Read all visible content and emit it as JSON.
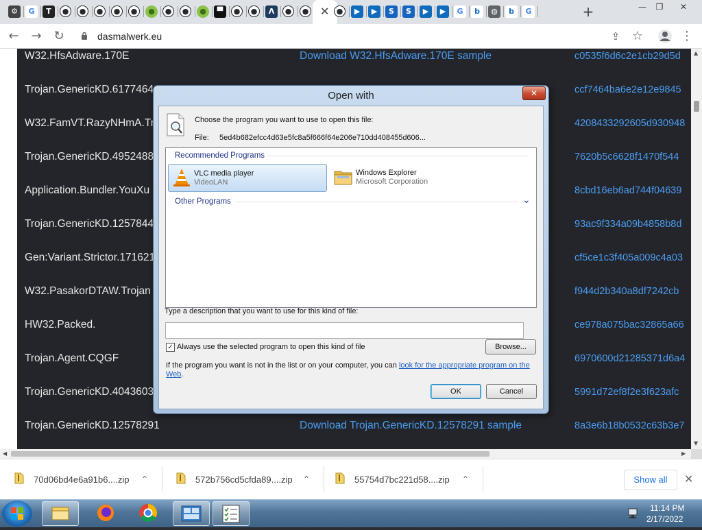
{
  "browser": {
    "tab_icons": [
      "ext",
      "google",
      "text-app",
      "github",
      "github",
      "github",
      "github",
      "github",
      "circle-green",
      "github",
      "github",
      "circle-green",
      "dark-box",
      "github",
      "github",
      "arrow-app",
      "github",
      "github",
      "active",
      "github",
      "bing-play",
      "bing-play",
      "s-app",
      "s-app",
      "bing-play",
      "bing-play",
      "google",
      "bing",
      "globe",
      "bing",
      "google"
    ],
    "active_tab_close": "✕",
    "new_tab": "+",
    "url": "dasmalwerk.eu",
    "window_controls": {
      "minimize": "—",
      "restore": "❐",
      "close": "✕"
    }
  },
  "page": {
    "rows": [
      {
        "name": "W32.HfsAdware.170E",
        "download": "Download W32.HfsAdware.170E sample",
        "hash": "c0535f6d6c2e1cb29d5d"
      },
      {
        "name": "Trojan.GenericKD.6177464",
        "download": "",
        "hash": "ccf7464ba6e2e12e9845"
      },
      {
        "name": "W32.FamVT.RazyNHmA.Tro",
        "download": "",
        "hash": "4208433292605d930948"
      },
      {
        "name": "Trojan.GenericKD.4952488",
        "download": "",
        "hash": "7620b5c6628f1470f544"
      },
      {
        "name": "Application.Bundler.YouXu",
        "download": "",
        "hash": "8cbd16eb6ad744f04639"
      },
      {
        "name": "Trojan.GenericKD.1257844",
        "download": "",
        "hash": "93ac9f334a09b4858b8d"
      },
      {
        "name": "Gen:Variant.Strictor.171621",
        "download": "",
        "hash": "cf5ce1c3f405a009c4a03"
      },
      {
        "name": "W32.PasakorDTAW.Trojan",
        "download": "",
        "hash": "f944d2b340a8df7242cb"
      },
      {
        "name": "HW32.Packed.",
        "download": "",
        "hash": "ce978a075bac32865a66"
      },
      {
        "name": "Trojan.Agent.CQGF",
        "download": "",
        "hash": "6970600d21285371d6a4"
      },
      {
        "name": "Trojan.GenericKD.4043603",
        "download": "",
        "hash": "5991d72ef8f2e3f623afc"
      },
      {
        "name": "Trojan.GenericKD.12578291",
        "download": "Download Trojan.GenericKD.12578291 sample",
        "hash": "8a3e6b18b0532c63b3e7"
      }
    ]
  },
  "dialog": {
    "title": "Open with",
    "close": "✕",
    "prompt": "Choose the program you want to use to open this file:",
    "file_label": "File:",
    "file_name": "5ed4b682efcc4d63e5fc8a5f666f64e206e710dd408455d606...",
    "recommended_label": "Recommended Programs",
    "programs": [
      {
        "name": "VLC media player",
        "publisher": "VideoLAN",
        "selected": true
      },
      {
        "name": "Windows Explorer",
        "publisher": "Microsoft Corporation",
        "selected": false
      }
    ],
    "other_label": "Other Programs",
    "other_chevron": "⌄",
    "description_label": "Type a description that you want to use for this kind of file:",
    "description_value": "",
    "always_use_label": "Always use the selected program to open this kind of file",
    "always_use_checked": true,
    "browse_label": "Browse...",
    "help_text": "If the program you want is not in the list or on your computer, you can",
    "help_link_1": "look for the appropriate program on the",
    "help_link_2": "Web",
    "help_suffix": ".",
    "ok_label": "OK",
    "cancel_label": "Cancel"
  },
  "downloads": {
    "items": [
      {
        "name": "70d06bd4e6a91b6....zip"
      },
      {
        "name": "572b756cd5cfda89....zip"
      },
      {
        "name": "55754d7bc221d58....zip"
      }
    ],
    "show_all": "Show all",
    "close": "✕",
    "chevron": "⌃"
  },
  "taskbar": {
    "apps": [
      "explorer",
      "firefox",
      "chrome",
      "control-panel",
      "task-list"
    ],
    "time": "11:14 PM",
    "date": "2/17/2022"
  },
  "colors": {
    "link": "#4b9cf0",
    "page_bg": "#23252a",
    "accent": "#1a73e8"
  }
}
